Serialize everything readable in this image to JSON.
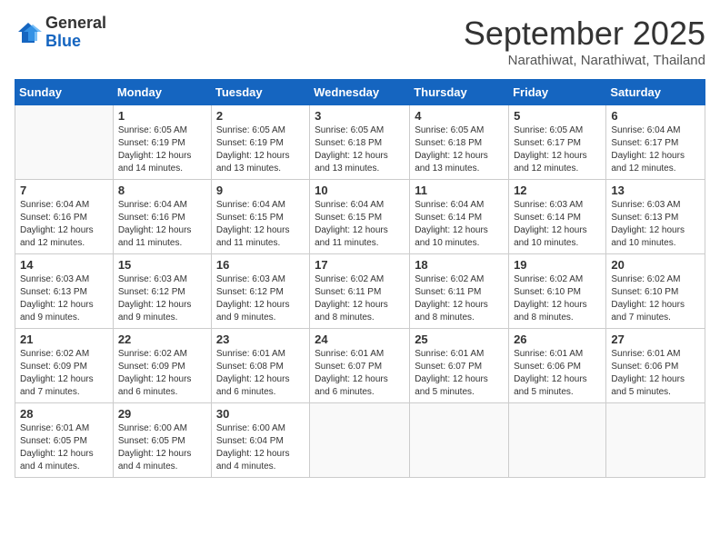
{
  "header": {
    "logo_general": "General",
    "logo_blue": "Blue",
    "month_title": "September 2025",
    "subtitle": "Narathiwat, Narathiwat, Thailand"
  },
  "days_of_week": [
    "Sunday",
    "Monday",
    "Tuesday",
    "Wednesday",
    "Thursday",
    "Friday",
    "Saturday"
  ],
  "weeks": [
    [
      {
        "day": "",
        "info": ""
      },
      {
        "day": "1",
        "info": "Sunrise: 6:05 AM\nSunset: 6:19 PM\nDaylight: 12 hours\nand 14 minutes."
      },
      {
        "day": "2",
        "info": "Sunrise: 6:05 AM\nSunset: 6:19 PM\nDaylight: 12 hours\nand 13 minutes."
      },
      {
        "day": "3",
        "info": "Sunrise: 6:05 AM\nSunset: 6:18 PM\nDaylight: 12 hours\nand 13 minutes."
      },
      {
        "day": "4",
        "info": "Sunrise: 6:05 AM\nSunset: 6:18 PM\nDaylight: 12 hours\nand 13 minutes."
      },
      {
        "day": "5",
        "info": "Sunrise: 6:05 AM\nSunset: 6:17 PM\nDaylight: 12 hours\nand 12 minutes."
      },
      {
        "day": "6",
        "info": "Sunrise: 6:04 AM\nSunset: 6:17 PM\nDaylight: 12 hours\nand 12 minutes."
      }
    ],
    [
      {
        "day": "7",
        "info": "Sunrise: 6:04 AM\nSunset: 6:16 PM\nDaylight: 12 hours\nand 12 minutes."
      },
      {
        "day": "8",
        "info": "Sunrise: 6:04 AM\nSunset: 6:16 PM\nDaylight: 12 hours\nand 11 minutes."
      },
      {
        "day": "9",
        "info": "Sunrise: 6:04 AM\nSunset: 6:15 PM\nDaylight: 12 hours\nand 11 minutes."
      },
      {
        "day": "10",
        "info": "Sunrise: 6:04 AM\nSunset: 6:15 PM\nDaylight: 12 hours\nand 11 minutes."
      },
      {
        "day": "11",
        "info": "Sunrise: 6:04 AM\nSunset: 6:14 PM\nDaylight: 12 hours\nand 10 minutes."
      },
      {
        "day": "12",
        "info": "Sunrise: 6:03 AM\nSunset: 6:14 PM\nDaylight: 12 hours\nand 10 minutes."
      },
      {
        "day": "13",
        "info": "Sunrise: 6:03 AM\nSunset: 6:13 PM\nDaylight: 12 hours\nand 10 minutes."
      }
    ],
    [
      {
        "day": "14",
        "info": "Sunrise: 6:03 AM\nSunset: 6:13 PM\nDaylight: 12 hours\nand 9 minutes."
      },
      {
        "day": "15",
        "info": "Sunrise: 6:03 AM\nSunset: 6:12 PM\nDaylight: 12 hours\nand 9 minutes."
      },
      {
        "day": "16",
        "info": "Sunrise: 6:03 AM\nSunset: 6:12 PM\nDaylight: 12 hours\nand 9 minutes."
      },
      {
        "day": "17",
        "info": "Sunrise: 6:02 AM\nSunset: 6:11 PM\nDaylight: 12 hours\nand 8 minutes."
      },
      {
        "day": "18",
        "info": "Sunrise: 6:02 AM\nSunset: 6:11 PM\nDaylight: 12 hours\nand 8 minutes."
      },
      {
        "day": "19",
        "info": "Sunrise: 6:02 AM\nSunset: 6:10 PM\nDaylight: 12 hours\nand 8 minutes."
      },
      {
        "day": "20",
        "info": "Sunrise: 6:02 AM\nSunset: 6:10 PM\nDaylight: 12 hours\nand 7 minutes."
      }
    ],
    [
      {
        "day": "21",
        "info": "Sunrise: 6:02 AM\nSunset: 6:09 PM\nDaylight: 12 hours\nand 7 minutes."
      },
      {
        "day": "22",
        "info": "Sunrise: 6:02 AM\nSunset: 6:09 PM\nDaylight: 12 hours\nand 6 minutes."
      },
      {
        "day": "23",
        "info": "Sunrise: 6:01 AM\nSunset: 6:08 PM\nDaylight: 12 hours\nand 6 minutes."
      },
      {
        "day": "24",
        "info": "Sunrise: 6:01 AM\nSunset: 6:07 PM\nDaylight: 12 hours\nand 6 minutes."
      },
      {
        "day": "25",
        "info": "Sunrise: 6:01 AM\nSunset: 6:07 PM\nDaylight: 12 hours\nand 5 minutes."
      },
      {
        "day": "26",
        "info": "Sunrise: 6:01 AM\nSunset: 6:06 PM\nDaylight: 12 hours\nand 5 minutes."
      },
      {
        "day": "27",
        "info": "Sunrise: 6:01 AM\nSunset: 6:06 PM\nDaylight: 12 hours\nand 5 minutes."
      }
    ],
    [
      {
        "day": "28",
        "info": "Sunrise: 6:01 AM\nSunset: 6:05 PM\nDaylight: 12 hours\nand 4 minutes."
      },
      {
        "day": "29",
        "info": "Sunrise: 6:00 AM\nSunset: 6:05 PM\nDaylight: 12 hours\nand 4 minutes."
      },
      {
        "day": "30",
        "info": "Sunrise: 6:00 AM\nSunset: 6:04 PM\nDaylight: 12 hours\nand 4 minutes."
      },
      {
        "day": "",
        "info": ""
      },
      {
        "day": "",
        "info": ""
      },
      {
        "day": "",
        "info": ""
      },
      {
        "day": "",
        "info": ""
      }
    ]
  ]
}
